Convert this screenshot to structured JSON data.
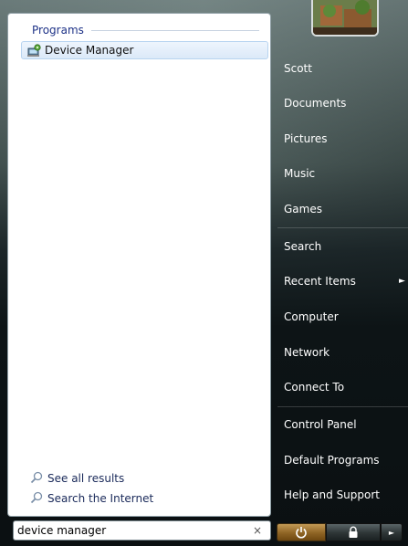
{
  "left_panel": {
    "section_title": "Programs",
    "result_label": "Device Manager",
    "see_all_label": "See all results",
    "search_internet_label": "Search the Internet"
  },
  "search": {
    "value": "device manager",
    "clear_symbol": "×"
  },
  "right_panel": {
    "items": [
      {
        "label": "Scott"
      },
      {
        "label": "Documents"
      },
      {
        "label": "Pictures"
      },
      {
        "label": "Music"
      },
      {
        "label": "Games"
      },
      {
        "label": "Search"
      },
      {
        "label": "Recent Items"
      },
      {
        "label": "Computer"
      },
      {
        "label": "Network"
      },
      {
        "label": "Connect To"
      },
      {
        "label": "Control Panel"
      },
      {
        "label": "Default Programs"
      },
      {
        "label": "Help and Support"
      }
    ],
    "recent_items_arrow": "►"
  },
  "power_bar": {
    "arrow_symbol": "►"
  },
  "icons": {
    "device_manager": "device-manager-icon",
    "search": "magnifier-icon",
    "power": "power-icon",
    "lock": "lock-icon"
  },
  "colors": {
    "section_title": "#1e3287",
    "result_highlight": "#dbe9f8",
    "power_button": "#8f6424",
    "right_text": "#ffffff"
  }
}
